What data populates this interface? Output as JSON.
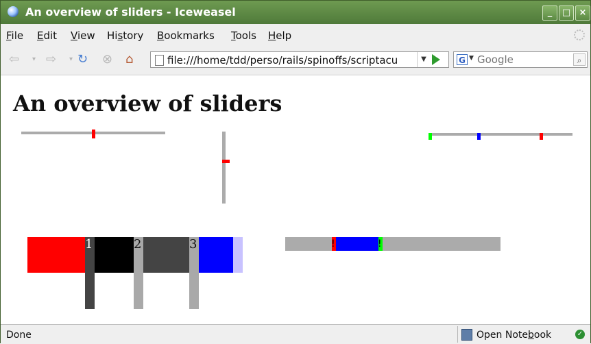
{
  "window": {
    "title": "An overview of sliders - Iceweasel",
    "controls": {
      "minimize": "_",
      "maximize": "□",
      "close": "×"
    }
  },
  "menu": {
    "items": [
      {
        "label": "File",
        "accel": "F"
      },
      {
        "label": "Edit",
        "accel": "E"
      },
      {
        "label": "View",
        "accel": "V"
      },
      {
        "label": "History",
        "accel": "s"
      },
      {
        "label": "Bookmarks",
        "accel": "B"
      },
      {
        "label": "Tools",
        "accel": "T"
      },
      {
        "label": "Help",
        "accel": "H"
      }
    ]
  },
  "navigation": {
    "url": "file:///home/tdd/perso/rails/spinoffs/scriptacu",
    "search_engine": "G",
    "search_placeholder": "Google",
    "icons": [
      "back-icon",
      "forward-icon",
      "reload-icon",
      "stop-icon",
      "home-icon",
      "page-icon",
      "go-icon",
      "search-icon"
    ]
  },
  "page": {
    "heading": "An overview of sliders",
    "sliders": {
      "horizontal_value": 0.5,
      "vertical_value": 0.42,
      "multi_handle_values": [
        0.0,
        0.35,
        0.78
      ],
      "multi_handle_colors": [
        "#00ff00",
        "#0000ff",
        "#ff0000"
      ],
      "segmented": {
        "labels": [
          "1",
          "2",
          "3"
        ],
        "colors": [
          "#ff0000",
          "#000000",
          "#444444",
          "#0000ff",
          "#c8c2ff"
        ]
      },
      "range": {
        "start_marker": "!",
        "end_marker": "!",
        "start_value": 0.22,
        "end_value": 0.44,
        "fill_color": "#0000ff",
        "start_color": "#ff0000",
        "end_color": "#00ff00"
      }
    }
  },
  "status": {
    "text": "Done",
    "notebook": "Open Notebook",
    "notebook_accel": "b"
  }
}
